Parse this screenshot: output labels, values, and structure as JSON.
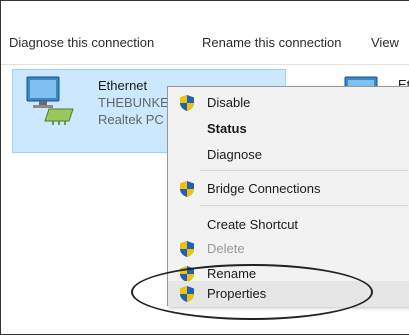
{
  "toolbar": {
    "diagnose_label": "Diagnose this connection",
    "rename_label": "Rename this connection",
    "view_label": "View"
  },
  "adapters": [
    {
      "name": "Ethernet",
      "line2": "THEBUNKE",
      "line3": "Realtek PC",
      "icon": "network-adapter-icon",
      "selected": true
    },
    {
      "name": "Et",
      "icon": "network-adapter-icon",
      "selected": false
    }
  ],
  "context_menu": {
    "items": [
      {
        "label": "Disable",
        "icon": "shield-icon",
        "bold": false,
        "disabled": false
      },
      {
        "label": "Status",
        "icon": "",
        "bold": true,
        "disabled": false
      },
      {
        "label": "Diagnose",
        "icon": "",
        "bold": false,
        "disabled": false
      },
      {
        "label": "Bridge Connections",
        "icon": "shield-icon",
        "bold": false,
        "disabled": false
      },
      {
        "label": "Create Shortcut",
        "icon": "",
        "bold": false,
        "disabled": false
      },
      {
        "label": "Delete",
        "icon": "shield-icon",
        "bold": false,
        "disabled": true
      },
      {
        "label": "Rename",
        "icon": "shield-icon",
        "bold": false,
        "disabled": false
      },
      {
        "label": "Properties",
        "icon": "shield-icon",
        "bold": false,
        "disabled": false,
        "highlighted": true
      }
    ]
  },
  "colors": {
    "selection": "#cce8ff",
    "menu_bg": "#f2f2f2",
    "shield_blue": "#1f5fbf",
    "shield_yellow": "#f2c200"
  }
}
